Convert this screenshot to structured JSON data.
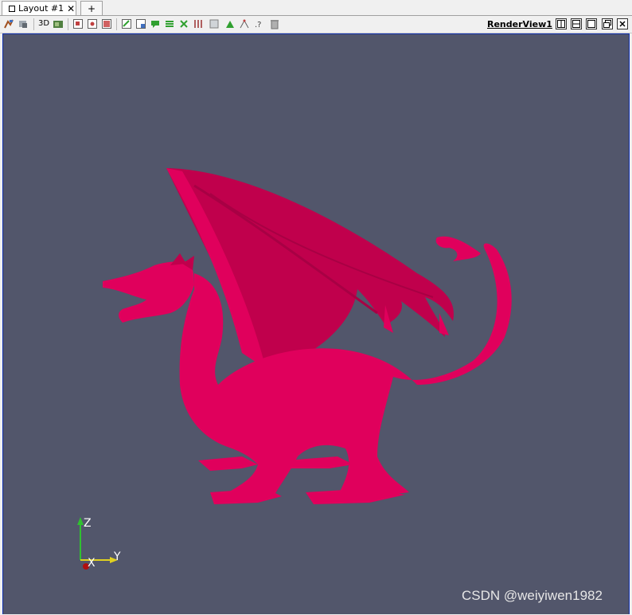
{
  "tabs": {
    "layout_label": "Layout #1",
    "close_glyph": "✕",
    "add_glyph": "+"
  },
  "toolbar": {
    "mode_3d": "3D",
    "view_name": "RenderView1",
    "icons": [
      "reset-camera-icon",
      "zoom-to-data-icon",
      "camera-icon",
      "select-cells-on-icon",
      "select-points-on-icon",
      "select-cells-through-icon",
      "select-points-through-icon",
      "select-block-icon",
      "interactive-select-icon",
      "grow-selection-icon",
      "shrink-selection-icon",
      "clear-selection-icon",
      "hover-points-icon",
      "hover-cells-icon",
      "query-icon",
      "delete-icon"
    ],
    "window_buttons": [
      "split-horizontal",
      "split-vertical",
      "maximize",
      "pop-out",
      "close"
    ]
  },
  "render_view": {
    "background": "#52566b",
    "model_color": "#e0005c",
    "axes": {
      "z_label": "Z",
      "y_label": "Y",
      "x_label": "X"
    }
  },
  "watermark": "CSDN @weiyiwen1982"
}
